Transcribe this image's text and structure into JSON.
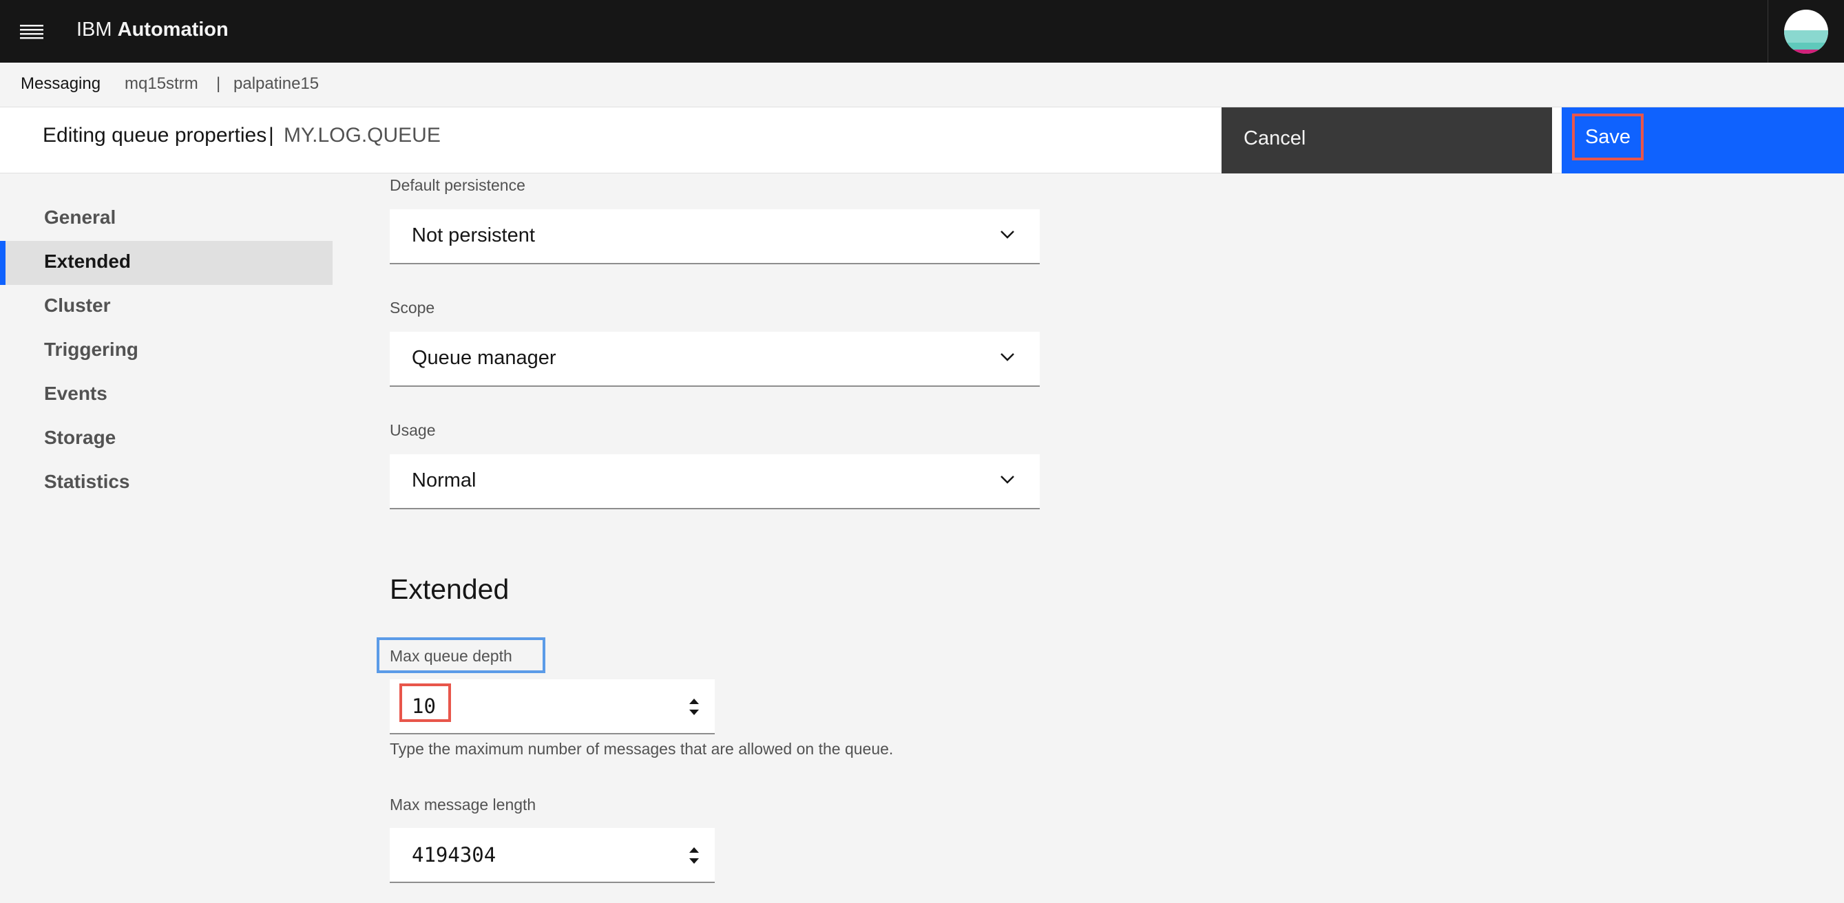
{
  "header": {
    "menu_icon": "hamburger-menu-icon",
    "brand_prefix": "IBM",
    "brand_name": "Automation",
    "avatar_icon": "user-avatar-icon"
  },
  "breadcrumb": {
    "root": "Messaging",
    "queue_manager": "mq15strm",
    "separator": "|",
    "host": "palpatine15"
  },
  "page_header": {
    "title": "Editing queue properties",
    "separator": "|",
    "queue_name": "MY.LOG.QUEUE",
    "cancel_label": "Cancel",
    "save_label": "Save"
  },
  "sidebar": {
    "items": [
      {
        "label": "General",
        "active": false
      },
      {
        "label": "Extended",
        "active": true
      },
      {
        "label": "Cluster",
        "active": false
      },
      {
        "label": "Triggering",
        "active": false
      },
      {
        "label": "Events",
        "active": false
      },
      {
        "label": "Storage",
        "active": false
      },
      {
        "label": "Statistics",
        "active": false
      }
    ]
  },
  "form": {
    "default_persistence": {
      "label": "Default persistence",
      "value": "Not persistent"
    },
    "scope": {
      "label": "Scope",
      "value": "Queue manager"
    },
    "usage": {
      "label": "Usage",
      "value": "Normal"
    },
    "extended_section_title": "Extended",
    "max_queue_depth": {
      "label": "Max queue depth",
      "value": "10",
      "helper": "Type the maximum number of messages that are allowed on the queue."
    },
    "max_message_length": {
      "label": "Max message length",
      "value": "4194304"
    }
  },
  "colors": {
    "header_bg": "#161616",
    "primary_blue": "#0f62fe",
    "cancel_bg": "#393939",
    "highlight_red": "#e8564b",
    "highlight_blue": "#5b9be8"
  }
}
